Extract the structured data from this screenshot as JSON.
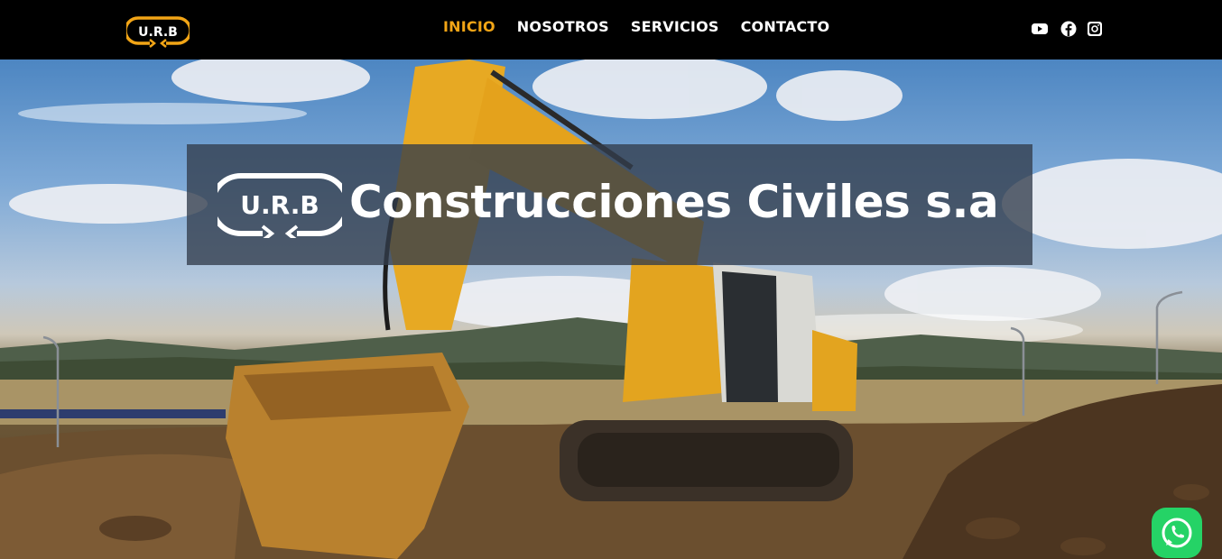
{
  "brand": {
    "logo_text": "U.R.B",
    "accent_color": "#f2a516"
  },
  "nav": {
    "items": [
      {
        "label": "INICIO",
        "active": true
      },
      {
        "label": "NOSOTROS",
        "active": false
      },
      {
        "label": "SERVICIOS",
        "active": false
      },
      {
        "label": "CONTACTO",
        "active": false
      }
    ],
    "social": [
      {
        "icon": "youtube-icon"
      },
      {
        "icon": "facebook-icon"
      },
      {
        "icon": "instagram-icon"
      }
    ]
  },
  "hero": {
    "title": "Construcciones Civiles s.a",
    "logo_text": "U.R.B",
    "image": "excavator-construction-site"
  },
  "whatsapp": {
    "icon": "whatsapp-icon",
    "color": "#25d366"
  }
}
